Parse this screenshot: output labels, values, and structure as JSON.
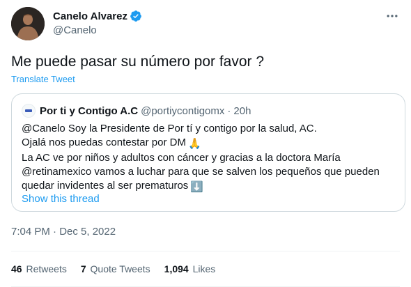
{
  "author": {
    "display_name": "Canelo Alvarez",
    "handle": "@Canelo",
    "avatar_icon": "profile-photo",
    "verified_icon": "verified-badge-icon"
  },
  "tweet": {
    "text": "Me puede pasar su número por favor ?",
    "translate_label": "Translate Tweet",
    "timestamp": "7:04 PM · Dec 5, 2022"
  },
  "quote": {
    "display_name": "Por ti y Contigo A.C",
    "handle": "@portiycontigomx",
    "separator": "·",
    "time": "20h",
    "lines": [
      "@Canelo Soy la Presidente de Por tí y contigo por la salud, AC.",
      "Ojalá nos puedas contestar por DM",
      "La AC ve por niños y adultos con cáncer y gracias a la doctora María",
      "@retinamexico vamos a luchar para que se salven los pequeños que pueden",
      "quedar invidentes al ser prematuros"
    ],
    "emoji_pray": "🙏",
    "emoji_arrow": "⬇️",
    "show_thread_label": "Show this thread"
  },
  "stats": {
    "retweets_count": "46",
    "retweets_label": "Retweets",
    "quotes_count": "7",
    "quotes_label": "Quote Tweets",
    "likes_count": "1,094",
    "likes_label": "Likes"
  },
  "colors": {
    "accent": "#1d9bf0",
    "secondary_text": "#536471",
    "border": "#cfd9de"
  }
}
